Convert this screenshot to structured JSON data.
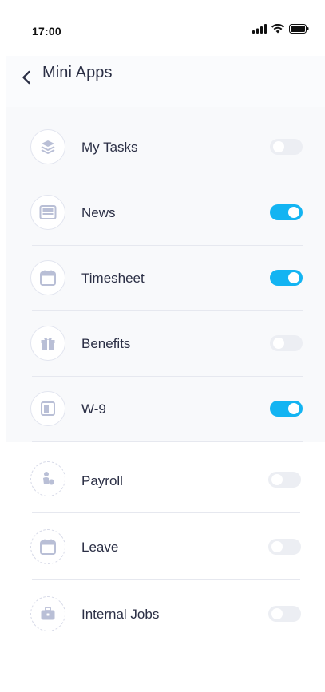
{
  "status_bar": {
    "time": "17:00"
  },
  "header": {
    "title": "Mini Apps"
  },
  "colors": {
    "toggle_on": "#13b4f2",
    "toggle_off": "#eceef3",
    "text": "#2b2f45"
  },
  "apps": [
    {
      "label": "My Tasks",
      "icon": "layers-icon",
      "enabled": false
    },
    {
      "label": "News",
      "icon": "newspaper-icon",
      "enabled": true
    },
    {
      "label": "Timesheet",
      "icon": "calendar-icon",
      "enabled": true
    },
    {
      "label": "Benefits",
      "icon": "gift-icon",
      "enabled": false
    },
    {
      "label": "W-9",
      "icon": "document-icon",
      "enabled": true
    },
    {
      "label": "Payroll",
      "icon": "payroll-icon",
      "enabled": false
    },
    {
      "label": "Leave",
      "icon": "calendar-icon",
      "enabled": false
    },
    {
      "label": "Internal Jobs",
      "icon": "briefcase-icon",
      "enabled": false
    }
  ]
}
